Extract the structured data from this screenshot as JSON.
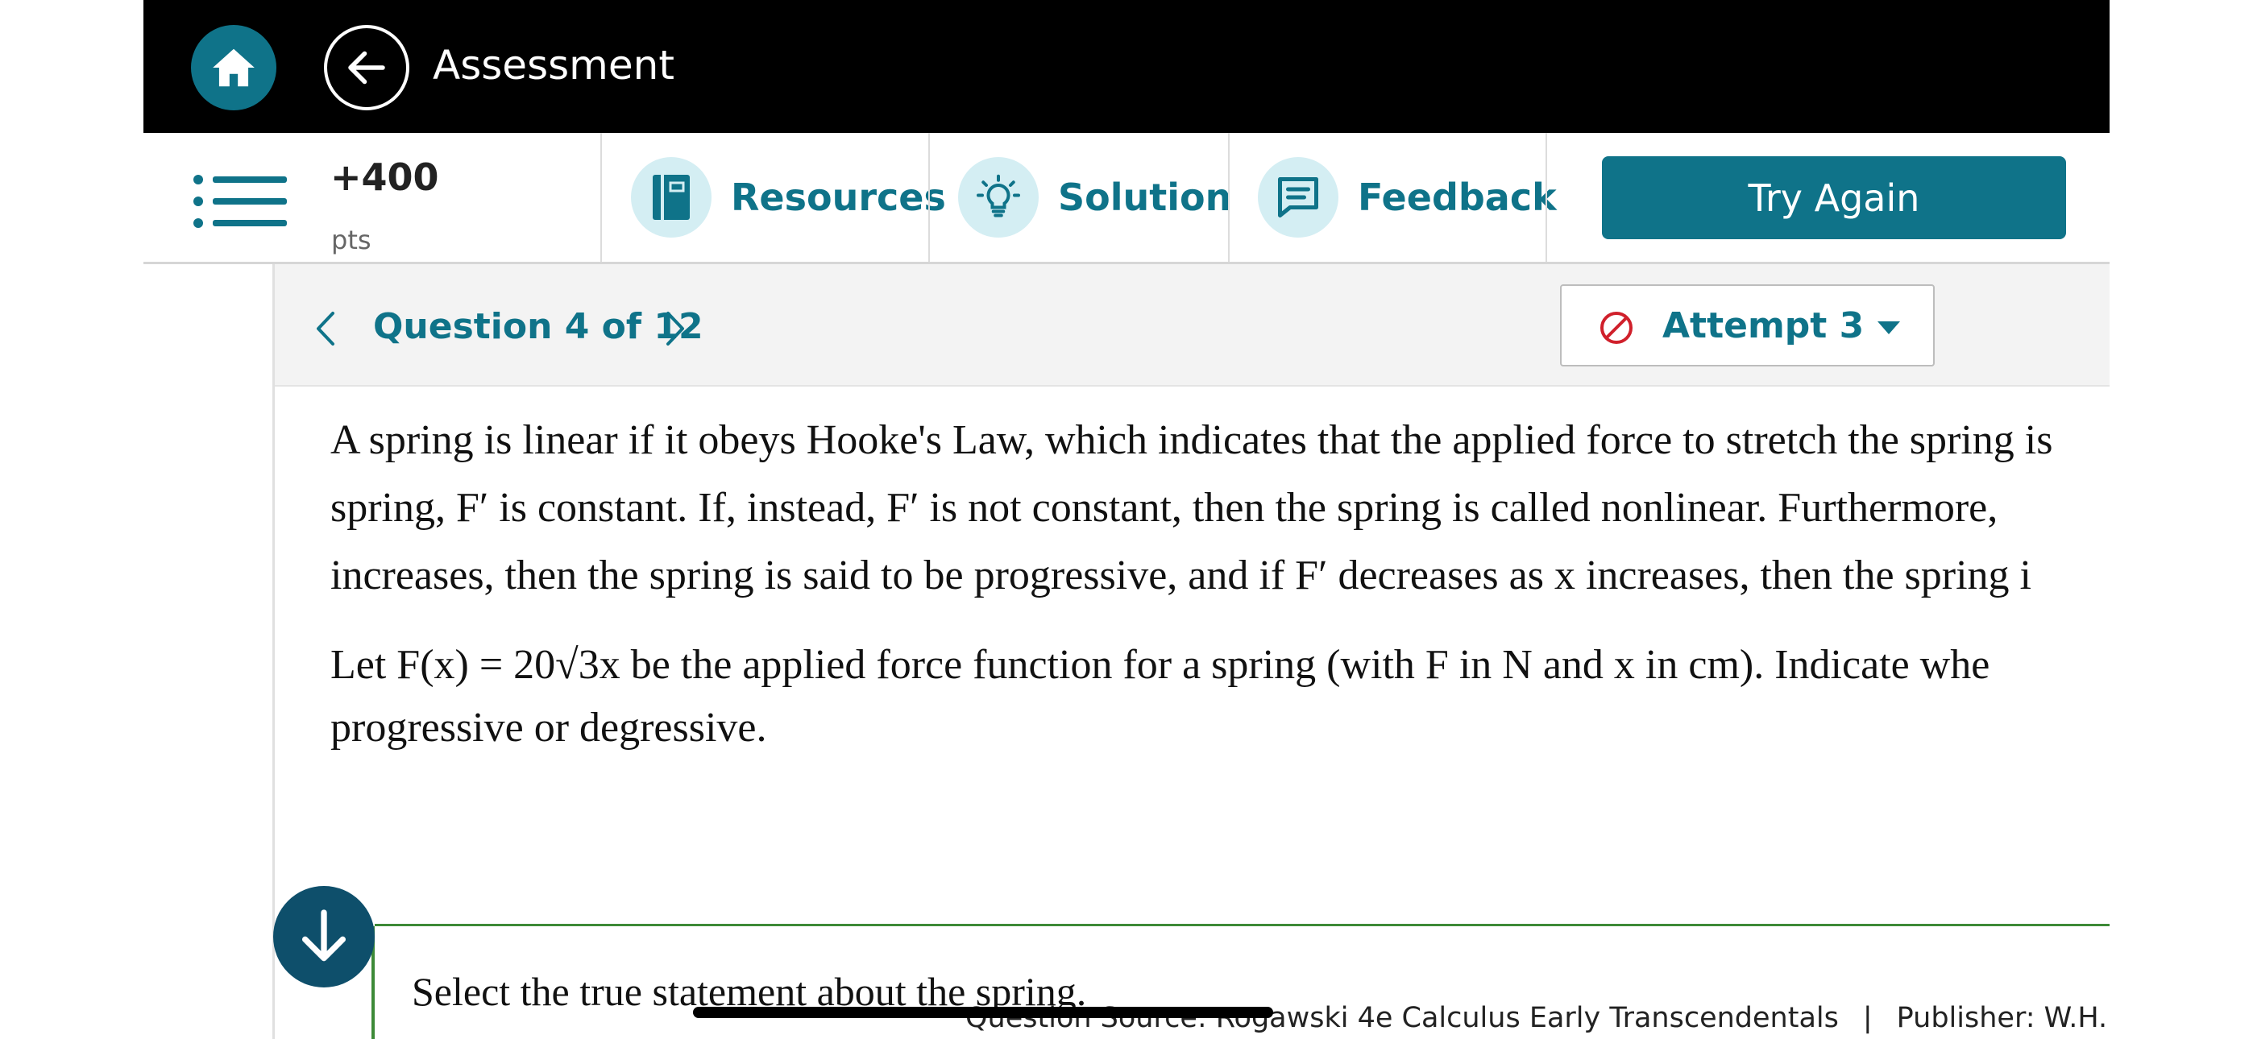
{
  "header": {
    "title": "Assessment",
    "home_icon": "home-icon",
    "back_icon": "arrow-left-icon"
  },
  "toolbar": {
    "points_value": "+400",
    "points_unit": "pts",
    "resources_label": "Resources",
    "solution_label": "Solution",
    "feedback_label": "Feedback",
    "try_again_label": "Try Again"
  },
  "question_nav": {
    "label": "Question 4 of 12",
    "attempt_label": "Attempt 3"
  },
  "question": {
    "para1": [
      "A spring is linear if it obeys Hooke's Law, which indicates that the applied force to stretch the spring is",
      "spring, F′ is constant. If, instead, F′ is not constant, then the spring is called nonlinear. Furthermore,",
      "increases, then the spring is said to be progressive, and if F′ decreases as x increases, then the spring i"
    ],
    "para2": [
      "Let F(x) = 20√3x be the applied force function for a spring (with F in N and x in cm). Indicate whe",
      "progressive or degressive."
    ]
  },
  "answer": {
    "prompt": "Select the true statement about the spring."
  },
  "footer": {
    "source": "Question Source: Rogawski 4e Calculus Early Transcendentals",
    "publisher": "Publisher: W.H. Freeman"
  },
  "colors": {
    "accent": "#0f7389",
    "accent_light": "#d4eef3",
    "header_bg": "#000000",
    "answer_border": "#3d8a37",
    "attempt_ban": "#d0202b"
  }
}
